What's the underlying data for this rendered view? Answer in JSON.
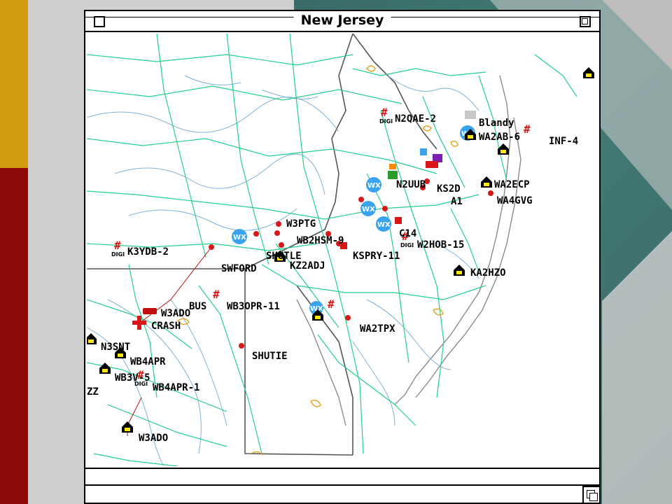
{
  "window": {
    "title": "New Jersey"
  },
  "colors": {
    "roads": "#22d08a",
    "rivers": "#7fb4d8",
    "borders": "#5a5a5a",
    "station": "#d81818",
    "wx": "#3aa3f0",
    "house": "#ffe800"
  },
  "stations": {
    "n2qae2": "N2QAE-2",
    "blandy": "Blandy",
    "wa2ab6": "WA2AB-6",
    "inf4": "INF-4",
    "wa2ecp": "WA2ECP",
    "wa4gvg": "WA4GVG",
    "ks2d": "KS2D",
    "n2uub": "N2UUB",
    "a1": "A1",
    "w3ptg": "W3PTG",
    "wb2hsm9": "WB2HSM-9",
    "shutle": "SHUTLE",
    "kz2adj": "KZ2ADJ",
    "w2hob15": "W2HOB-15",
    "ka2hzo": "KA2HZO",
    "k3ydb2": "K3YDB-2",
    "swford": "SWFORD",
    "w3ado": "W3ADO",
    "crash": "CRASH",
    "bus": "BUS",
    "wb3opr11": "WB3OPR-11",
    "wa2tpx": "WA2TPX",
    "shutie": "SHUTIE",
    "n3snt": "N3SNT",
    "wb4apr": "WB4APR",
    "wb3v5": "WB3V-5",
    "wb4apr1": "WB4APR-1",
    "w3ado2": "W3ADO",
    "c14": "C14",
    "kspry11": "KSPRY-11",
    "zz": "ZZ",
    "digi": "DIGI",
    "wx": "WX"
  }
}
